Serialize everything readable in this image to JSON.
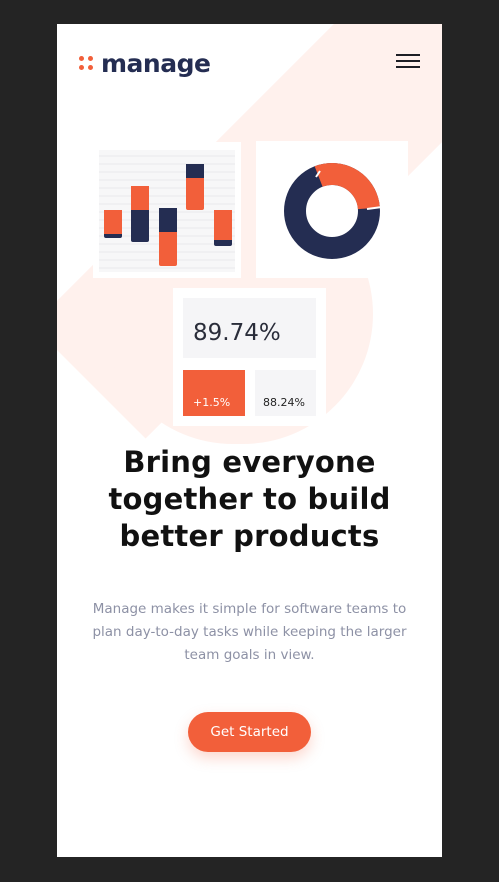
{
  "header": {
    "logo_text": "manage",
    "logo_icon": "four-dots-logo",
    "menu_icon": "hamburger-menu-icon"
  },
  "colors": {
    "accent": "#f25f3a",
    "navy": "#242d52",
    "tint": "#fff1ed",
    "text_muted": "#8d91a5"
  },
  "illustration": {
    "stat_main": "89.74%",
    "stat_change": "+1.5%",
    "stat_secondary": "88.24%"
  },
  "hero": {
    "headline": "Bring everyone together to build better products",
    "description": "Manage makes it simple for software teams to plan day-to-day tasks while keeping the larger team goals in view.",
    "cta_label": "Get Started"
  }
}
